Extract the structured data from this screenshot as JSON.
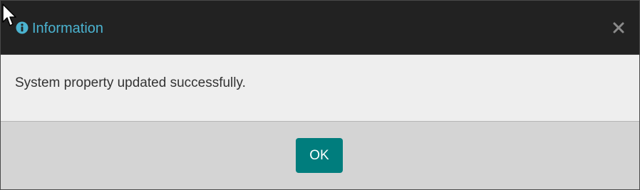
{
  "dialog": {
    "title": "Information",
    "title_icon": "info-circle-icon",
    "close_icon": "close-icon",
    "close_symbol": "×",
    "message": "System property updated successfully.",
    "ok_label": "OK"
  },
  "colors": {
    "header_bg": "#222222",
    "title_color": "#4bb3d0",
    "body_bg": "#eeeeee",
    "footer_bg": "#d4d4d4",
    "button_bg": "#007d7d",
    "button_text": "#ffffff"
  }
}
